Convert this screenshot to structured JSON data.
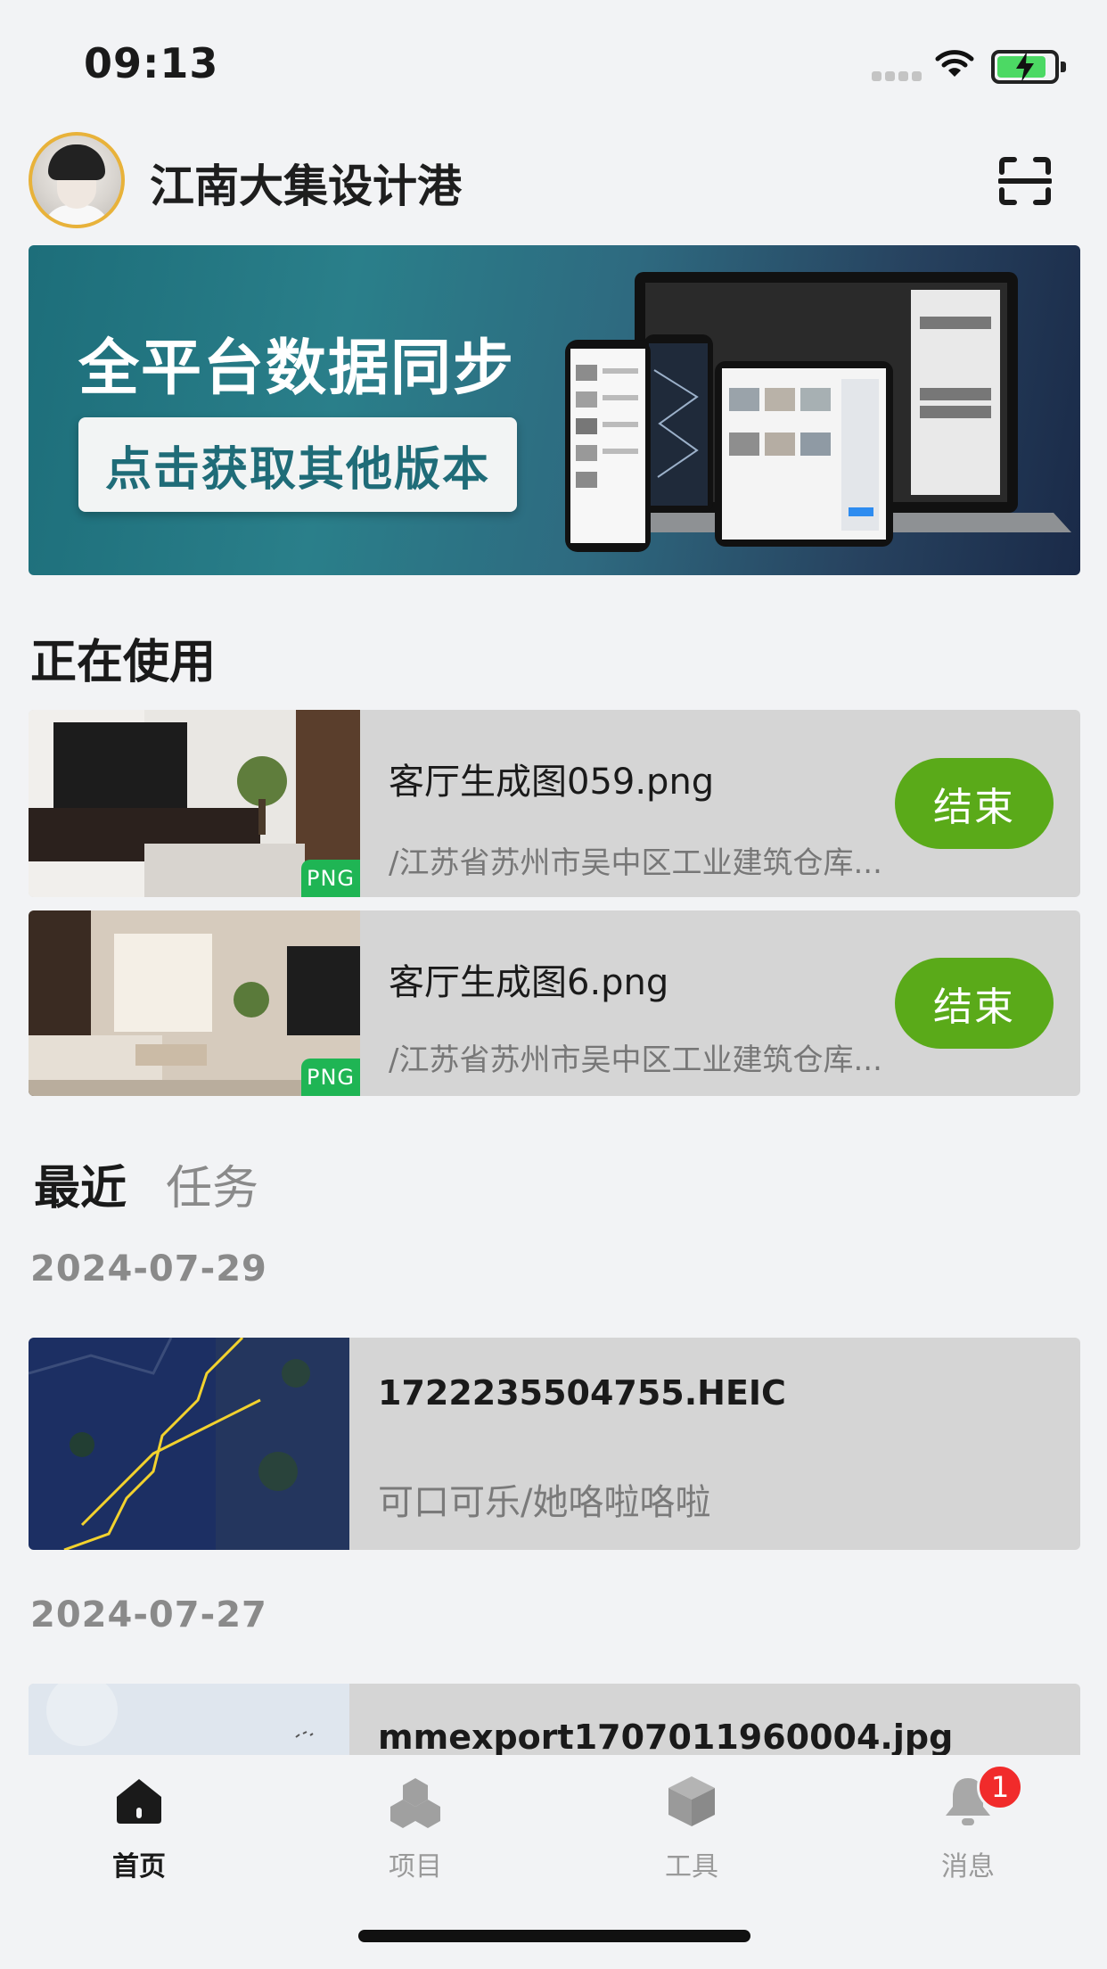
{
  "status_bar": {
    "time": "09:13"
  },
  "header": {
    "title": "江南大集设计港",
    "avatar_icon": "user-avatar",
    "scan_icon": "scan-icon"
  },
  "banner": {
    "headline": "全平台数据同步",
    "button_label": "点击获取其他版本"
  },
  "in_use": {
    "heading": "正在使用",
    "items": [
      {
        "name": "客厅生成图059.png",
        "path": "/江苏省苏州市吴中区工业建筑仓库...",
        "badge": "PNG",
        "action": "结束"
      },
      {
        "name": "客厅生成图6.png",
        "path": "/江苏省苏州市吴中区工业建筑仓库...",
        "badge": "PNG",
        "action": "结束"
      }
    ]
  },
  "tabs": [
    {
      "label": "最近",
      "active": true
    },
    {
      "label": "任务",
      "active": false
    }
  ],
  "recent": [
    {
      "date": "2024-07-29",
      "items": [
        {
          "name": "1722235504755.HEIC",
          "path": "可口可乐/她咯啦咯啦"
        }
      ]
    },
    {
      "date": "2024-07-27",
      "items": [
        {
          "name": "mmexport1707011960004.jpg",
          "path": ""
        }
      ]
    }
  ],
  "bottom_nav": {
    "items": [
      {
        "label": "首页",
        "icon": "home-icon",
        "active": true
      },
      {
        "label": "项目",
        "icon": "project-icon",
        "active": false
      },
      {
        "label": "工具",
        "icon": "tool-box-icon",
        "active": false
      },
      {
        "label": "消息",
        "icon": "bell-icon",
        "active": false,
        "badge": "1"
      }
    ]
  },
  "colors": {
    "accent_green": "#5aaa19",
    "badge_green": "#1fb554",
    "badge_red": "#f12b2b",
    "banner_teal": "#2a7f8a"
  }
}
